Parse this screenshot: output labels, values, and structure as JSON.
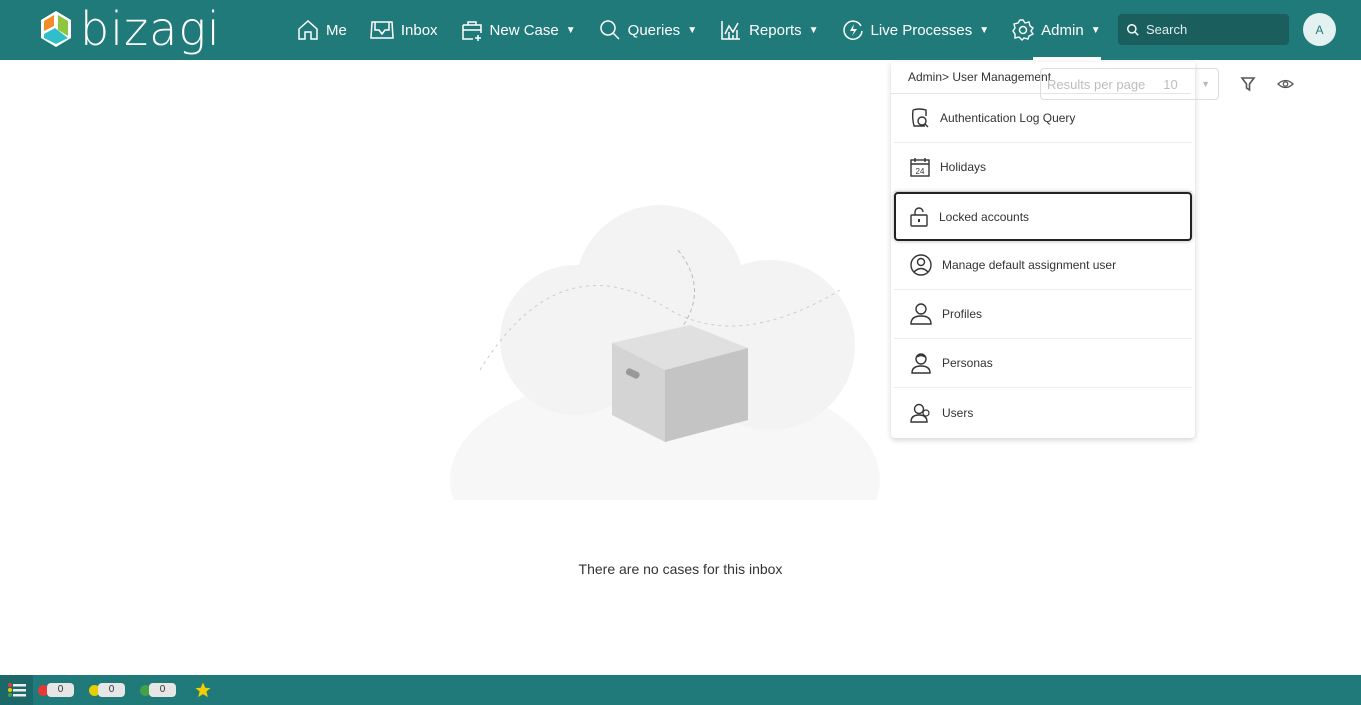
{
  "header": {
    "logo_text": "bizagi",
    "nav": [
      {
        "label": "Me",
        "icon": "home-icon",
        "dropdown": false
      },
      {
        "label": "Inbox",
        "icon": "inbox-icon",
        "dropdown": false
      },
      {
        "label": "New Case",
        "icon": "new-case-icon",
        "dropdown": true
      },
      {
        "label": "Queries",
        "icon": "search-icon",
        "dropdown": true
      },
      {
        "label": "Reports",
        "icon": "reports-icon",
        "dropdown": true
      },
      {
        "label": "Live Processes",
        "icon": "live-processes-icon",
        "dropdown": true
      },
      {
        "label": "Admin",
        "icon": "gear-icon",
        "dropdown": true,
        "active": true
      }
    ],
    "search_placeholder": "Search",
    "avatar_initial": "A"
  },
  "toolbar": {
    "results_per_page_label": "Results per page",
    "results_per_page_value": "10"
  },
  "admin_menu": {
    "breadcrumb": "Admin> User Management",
    "items": [
      {
        "label": "Authentication Log Query",
        "icon": "auth-log-icon"
      },
      {
        "label": "Holidays",
        "icon": "calendar-icon",
        "icon_text": "24"
      },
      {
        "label": "Locked accounts",
        "icon": "unlock-icon",
        "highlighted": true
      },
      {
        "label": "Manage default assignment user",
        "icon": "user-circle-icon"
      },
      {
        "label": "Profiles",
        "icon": "user-icon"
      },
      {
        "label": "Personas",
        "icon": "persona-icon"
      },
      {
        "label": "Users",
        "icon": "users-icon"
      }
    ]
  },
  "main": {
    "empty_message": "There are no cases for this inbox"
  },
  "footer": {
    "counters": [
      {
        "color": "#e53935",
        "value": "0"
      },
      {
        "color": "#e6cf00",
        "value": "0"
      },
      {
        "color": "#43a047",
        "value": "0"
      }
    ]
  },
  "colors": {
    "brand": "#217a7a"
  }
}
